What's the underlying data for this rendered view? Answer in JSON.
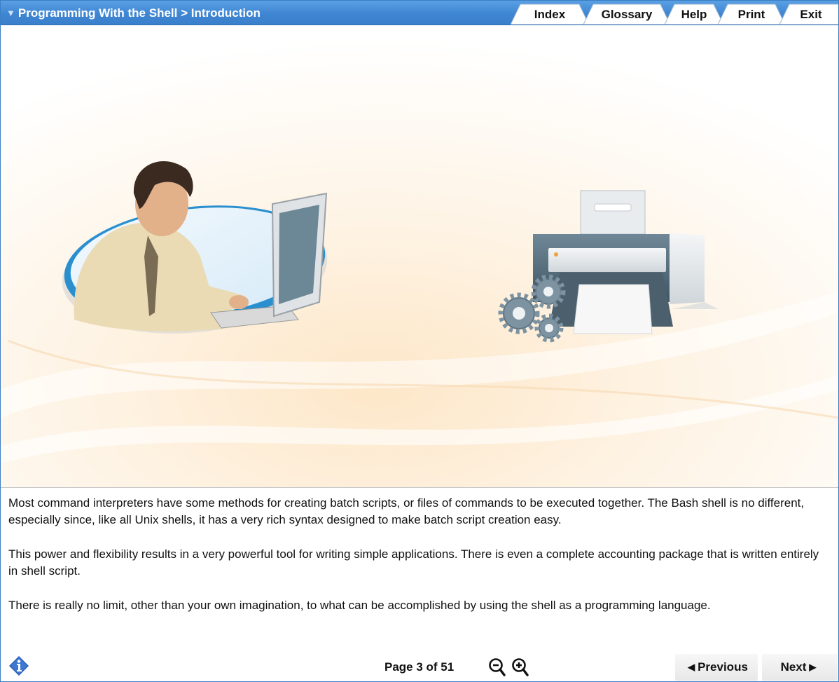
{
  "header": {
    "breadcrumb": "Programming With the Shell > Introduction",
    "tabs": [
      {
        "label": "Index"
      },
      {
        "label": "Glossary"
      },
      {
        "label": "Help"
      },
      {
        "label": "Print"
      },
      {
        "label": "Exit"
      }
    ]
  },
  "content": {
    "paragraphs": [
      "Most command interpreters have some methods for creating batch scripts, or files of commands to be executed together. The Bash shell is no different, especially since, like all Unix shells, it has a very rich syntax designed to make batch script creation easy.",
      "This power and flexibility results in a very powerful tool for writing simple applications. There is even a complete accounting package that is written entirely in shell script.",
      "There is really no limit, other than your own imagination, to what can be accomplished by using the shell as a programming language."
    ]
  },
  "footer": {
    "page_text": "Page 3 of 51",
    "previous_label": "Previous",
    "next_label": "Next",
    "prev_arrow": "◀",
    "next_arrow": "▶"
  },
  "colors": {
    "header": "#3f86d3",
    "accent_blue": "#2a8fcf",
    "info_icon": "#2b5fb8"
  },
  "icons": [
    "dropdown-triangle-icon",
    "info-icon",
    "zoom-out-icon",
    "zoom-in-icon"
  ]
}
